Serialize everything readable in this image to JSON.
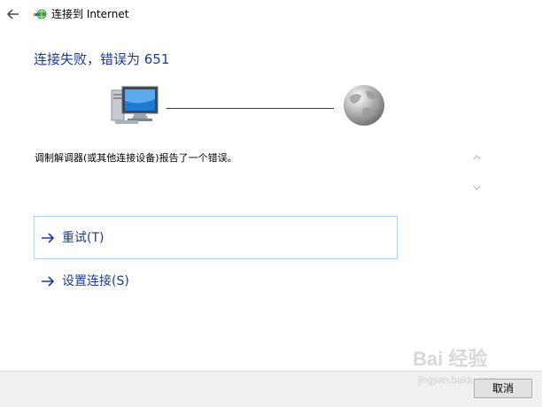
{
  "window": {
    "title": "连接到 Internet"
  },
  "page": {
    "heading": "连接失败，错误为 651",
    "message": "调制解调器(或其他连接设备)报告了一个错误。"
  },
  "icons": {
    "back": "back-arrow-icon",
    "network": "network-connection-icon",
    "computer": "computer-icon",
    "globe": "globe-icon",
    "command_arrow": "arrow-right-icon"
  },
  "actions": {
    "retry_label": "重试(T)",
    "setup_label": "设置连接(S)"
  },
  "footer": {
    "cancel_label": "取消"
  },
  "watermark": {
    "brand": "Bai 经验",
    "url": "jingyan.baidu.com"
  },
  "colors": {
    "heading": "#1b3b8c",
    "link": "#1b3b8c",
    "selected_border": "#b5d3f0",
    "footer_bg": "#f0f0f0"
  }
}
